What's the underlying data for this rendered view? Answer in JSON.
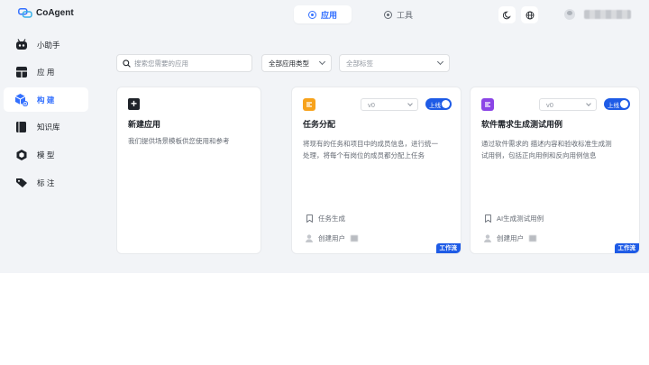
{
  "app": {
    "brand": "CoAgent"
  },
  "top_tabs": [
    {
      "label": "应用",
      "active": true
    },
    {
      "label": "工具",
      "active": false
    }
  ],
  "top_icons": [
    "moon-icon",
    "globe-icon"
  ],
  "sidebar": {
    "items": [
      {
        "label": "小助手",
        "icon": "robot-icon",
        "active": false
      },
      {
        "label": "应 用",
        "icon": "cube-icon",
        "active": false
      },
      {
        "label": "构 建",
        "icon": "build-icon",
        "active": true
      },
      {
        "label": "知识库",
        "icon": "book-icon",
        "active": false
      },
      {
        "label": "模 型",
        "icon": "model-icon",
        "active": false
      },
      {
        "label": "标 注",
        "icon": "tag-icon",
        "active": false
      }
    ]
  },
  "filters": {
    "search_placeholder": "搜索您需要的应用",
    "type_select": "全部应用类型",
    "tag_select": "全部标签"
  },
  "new_card": {
    "title": "新建应用",
    "desc": "我们提供场景模板供您使用和参考"
  },
  "apps": [
    {
      "title": "任务分配",
      "version": "v0",
      "status": "上线",
      "desc_line1": "将现有的任务和项目中的成员信息，进行统一",
      "desc_line2": "处理，将每个有岗位的成员都分配上任务",
      "tag": "任务生成",
      "creator_label": "创建用户",
      "badge": "工作流",
      "icon_color": "#f7a21b"
    },
    {
      "title": "软件需求生成测试用例",
      "version": "v0",
      "status": "上线",
      "desc_line1": "通过软件需求的 描述内容和验收标准生成测",
      "desc_line2": "试用例，包括正向用例和反向用例信息",
      "tag": "AI生成测试用例",
      "creator_label": "创建用户",
      "badge": "工作流",
      "icon_color": "#8b45e6"
    }
  ],
  "colors": {
    "accent": "#3370ff",
    "badge": "#1e5be6",
    "background": "#f2f4f7"
  }
}
